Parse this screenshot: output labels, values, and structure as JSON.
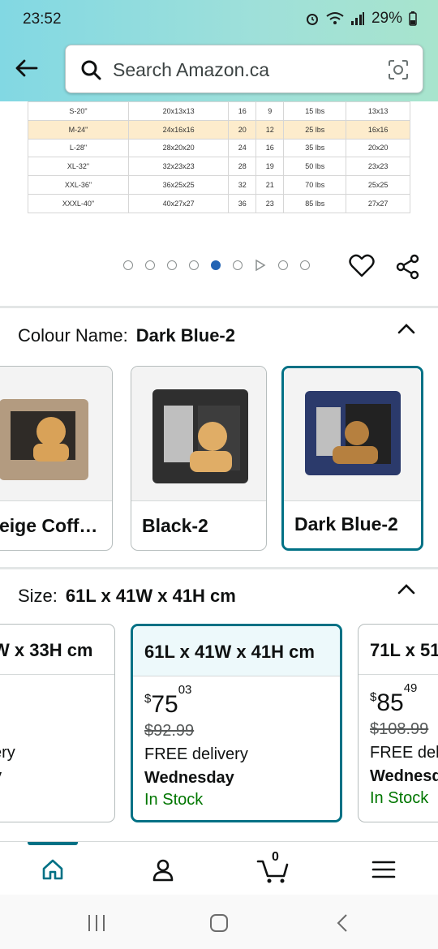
{
  "status": {
    "time": "23:52",
    "battery": "29%"
  },
  "search": {
    "placeholder": "Search Amazon.ca"
  },
  "size_table": [
    [
      "S-20\"",
      "20x13x13",
      "16",
      "9",
      "15 lbs",
      "13x13"
    ],
    [
      "M-24\"",
      "24x16x16",
      "20",
      "12",
      "25 lbs",
      "16x16"
    ],
    [
      "L-28\"",
      "28x20x20",
      "24",
      "16",
      "35 lbs",
      "20x20"
    ],
    [
      "XL-32\"",
      "32x23x23",
      "28",
      "19",
      "50 lbs",
      "23x23"
    ],
    [
      "XXL-36\"",
      "36x25x25",
      "32",
      "21",
      "70 lbs",
      "25x25"
    ],
    [
      "XXXL-40\"",
      "40x27x27",
      "36",
      "23",
      "85 lbs",
      "27x27"
    ]
  ],
  "colour": {
    "label": "Colour Name:",
    "value": "Dark Blue-2",
    "options": [
      {
        "name": "eige Coff…",
        "color": "#b39b80"
      },
      {
        "name": "Black-2",
        "color": "#2f2f2f"
      },
      {
        "name": "Dark Blue-2",
        "color": "#2b3a6b"
      }
    ]
  },
  "size": {
    "label": "Size:",
    "value": "61L x 41W x 41H cm",
    "options": [
      {
        "name": "W x 33H cm",
        "delivery": "ery",
        "day": "y"
      },
      {
        "name": "61L x 41W x 41H cm",
        "symbol": "$",
        "price_whole": "75",
        "price_fraction": "03",
        "was": "$92.99",
        "delivery": "FREE delivery",
        "day": "Wednesday",
        "stock": "In Stock"
      },
      {
        "name": "71L x 51",
        "symbol": "$",
        "price_whole": "85",
        "price_fraction": "49",
        "was": "$108.99",
        "delivery": "FREE deli",
        "day": "Wednesd",
        "stock": "In Stock"
      }
    ]
  },
  "cart": {
    "count": "0"
  },
  "colors": {
    "accent": "#007185",
    "stock": "#007600",
    "active_dot": "#2364b4"
  },
  "icons": [
    "back-arrow-icon",
    "search-icon",
    "camera-icon",
    "heart-icon",
    "share-icon",
    "chevron-up-icon",
    "home-icon",
    "account-icon",
    "cart-icon",
    "menu-icon"
  ]
}
